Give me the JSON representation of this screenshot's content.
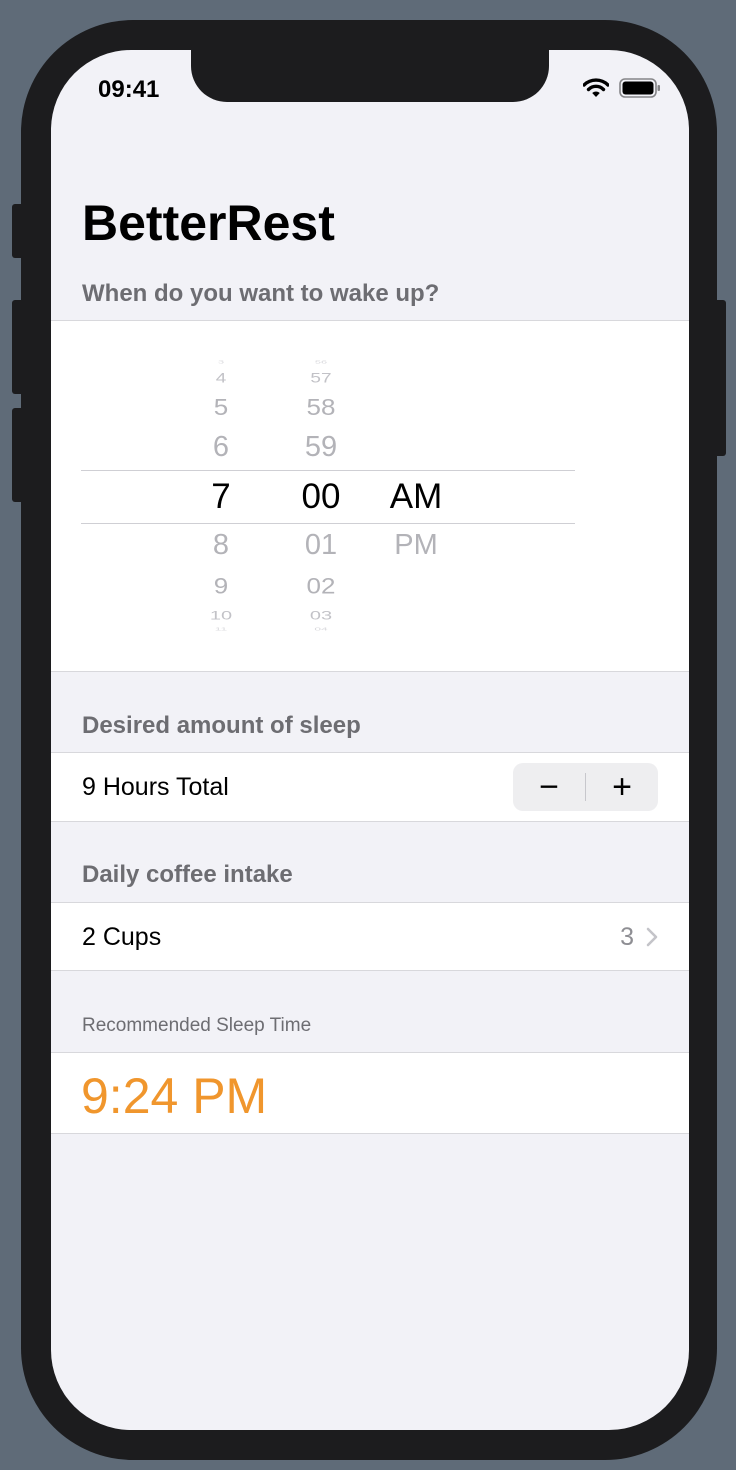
{
  "status_bar": {
    "time": "09:41"
  },
  "nav": {
    "title": "BetterRest"
  },
  "wake_section": {
    "header": "When do you want to wake up?",
    "picker": {
      "hours": [
        "3",
        "4",
        "5",
        "6",
        "7",
        "8",
        "9",
        "10",
        "11"
      ],
      "minutes": [
        "56",
        "57",
        "58",
        "59",
        "00",
        "01",
        "02",
        "03",
        "04"
      ],
      "periods": [
        "AM",
        "PM"
      ],
      "selected": {
        "hour": "7",
        "minute": "00",
        "period": "AM"
      }
    }
  },
  "sleep_section": {
    "header": "Desired amount of sleep",
    "label": "9 Hours Total",
    "decrement": "−",
    "increment": "+"
  },
  "coffee_section": {
    "header": "Daily coffee intake",
    "label": "2 Cups",
    "value": "3"
  },
  "result_section": {
    "header": "Recommended Sleep Time",
    "value": "9:24 PM"
  },
  "colors": {
    "accent": "#f0962d",
    "background": "#f2f2f7"
  },
  "icons": {
    "wifi": "wifi-icon",
    "battery": "battery-icon",
    "chevron": "chevron-right-icon"
  }
}
